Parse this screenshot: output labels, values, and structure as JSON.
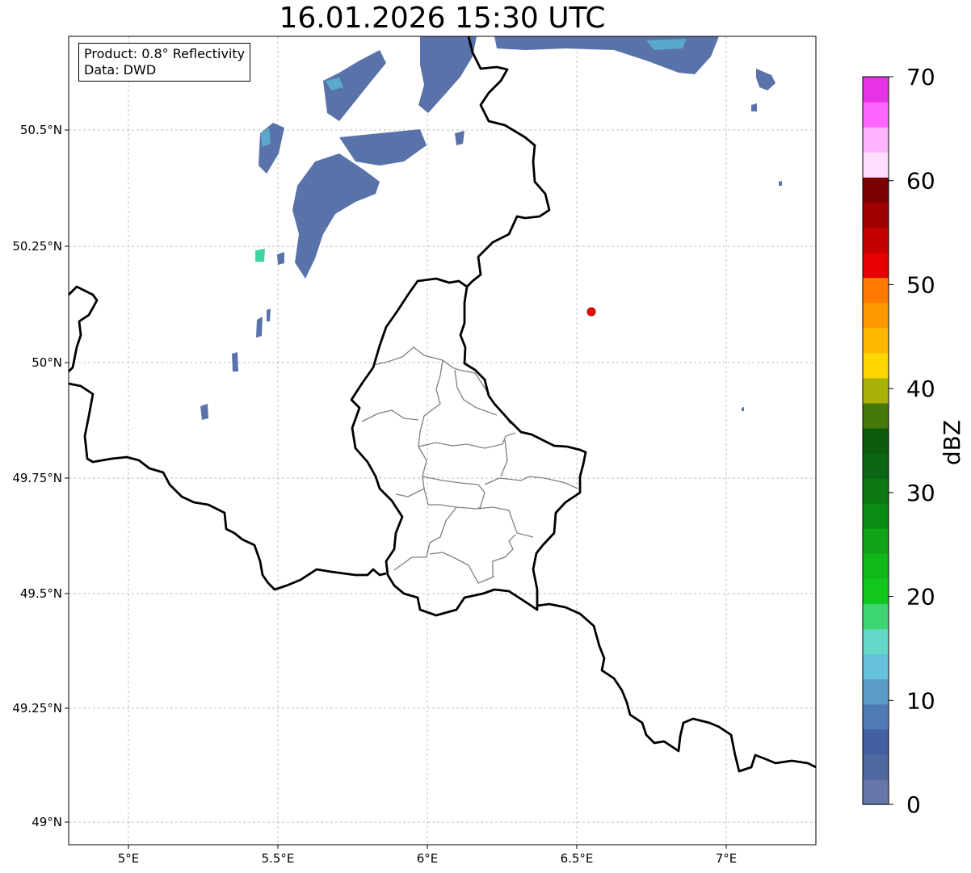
{
  "title": "16.01.2026 15:30 UTC",
  "info": {
    "product": "Product: 0.8° Reflectivity",
    "source": "Data: DWD"
  },
  "axes": {
    "lon_labels": [
      "5°E",
      "5.5°E",
      "6°E",
      "6.5°E",
      "7°E"
    ],
    "lat_labels": [
      "50.5°N",
      "50.25°N",
      "50°N",
      "49.75°N",
      "49.5°N",
      "49.25°N",
      "49°N"
    ]
  },
  "colorbar": {
    "label": "dBZ",
    "tick_labels": [
      "0",
      "10",
      "20",
      "30",
      "40",
      "50",
      "60",
      "70"
    ],
    "colors": [
      "#6576a8",
      "#5068a0",
      "#4260a3",
      "#4f7bb5",
      "#5a9bc8",
      "#66c2dc",
      "#63d8c6",
      "#3ed672",
      "#11c61c",
      "#10b918",
      "#10a416",
      "#0c8b14",
      "#0b7812",
      "#0a6612",
      "#0b5c0a",
      "#457a0a",
      "#aab208",
      "#ffd700",
      "#ffb800",
      "#ff9900",
      "#ff7a00",
      "#e60000",
      "#c40000",
      "#a00000",
      "#7a0000",
      "#ffddff",
      "#ffb3ff",
      "#ff66ff",
      "#e633e6"
    ]
  },
  "marker": {
    "color": "#ff0000"
  },
  "colors": {
    "border": "#000000",
    "district": "#808080",
    "grid": "#aaaaaa"
  }
}
